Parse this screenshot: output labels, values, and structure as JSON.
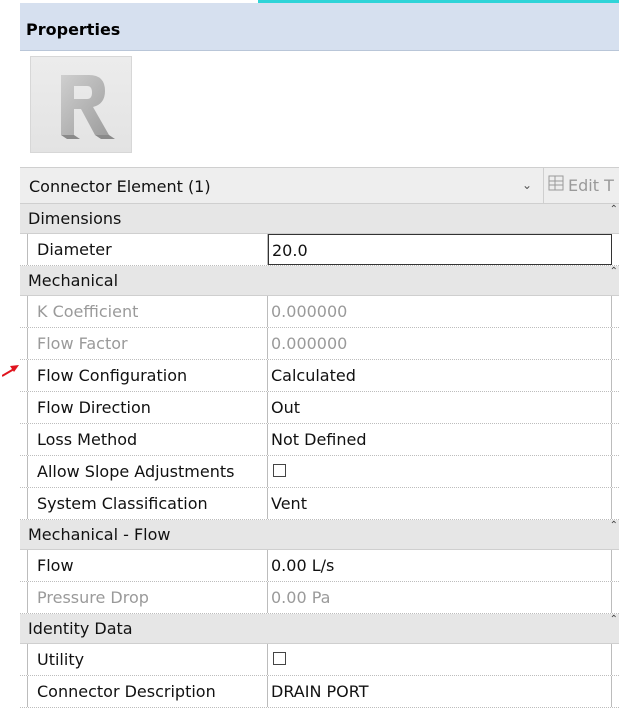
{
  "panel": {
    "title": "Properties",
    "preview_icon": "revit-family-icon"
  },
  "type_selector": {
    "label": "Connector Element (1)",
    "dropdown_icon": "chevron-down-icon",
    "edit_type_label": "Edit T",
    "edit_type_icon": "edit-type-icon"
  },
  "groups": [
    {
      "title": "Dimensions",
      "rows": [
        {
          "name": "Diameter",
          "value": "20.0",
          "disabled": false,
          "active": true
        }
      ]
    },
    {
      "title": "Mechanical",
      "rows": [
        {
          "name": "K Coefficient",
          "value": "0.000000",
          "disabled": true
        },
        {
          "name": "Flow Factor",
          "value": "0.000000",
          "disabled": true
        },
        {
          "name": "Flow Configuration",
          "value": "Calculated",
          "disabled": false
        },
        {
          "name": "Flow Direction",
          "value": "Out",
          "disabled": false
        },
        {
          "name": "Loss Method",
          "value": "Not Defined",
          "disabled": false
        },
        {
          "name": "Allow Slope Adjustments",
          "value": "",
          "checkbox": true,
          "checked": false,
          "disabled": false
        },
        {
          "name": "System Classification",
          "value": "Vent",
          "disabled": false
        }
      ]
    },
    {
      "title": "Mechanical - Flow",
      "rows": [
        {
          "name": "Flow",
          "value": "0.00 L/s",
          "disabled": false
        },
        {
          "name": "Pressure Drop",
          "value": "0.00 Pa",
          "disabled": true
        }
      ]
    },
    {
      "title": "Identity Data",
      "rows": [
        {
          "name": "Utility",
          "value": "",
          "checkbox": true,
          "checked": false,
          "disabled": false
        },
        {
          "name": "Connector Description",
          "value": "DRAIN PORT",
          "disabled": false
        }
      ]
    }
  ],
  "colors": {
    "title_bar": "#d6e0ef",
    "group_bg": "#e6e6e6",
    "disabled_text": "#9a9a9a",
    "accent_line": "#2fd4d8",
    "annotation_arrow": "#e0141e"
  }
}
